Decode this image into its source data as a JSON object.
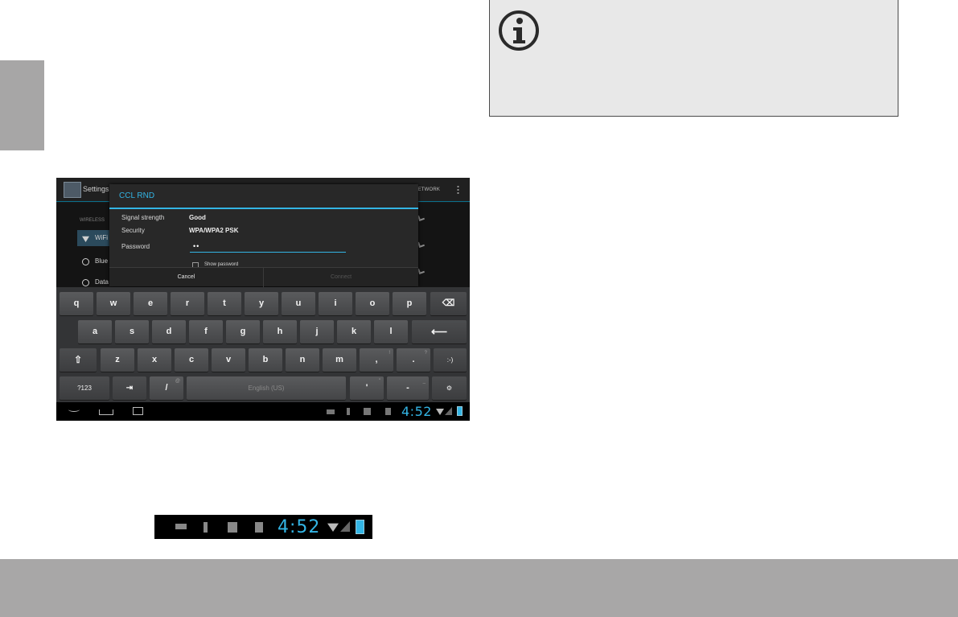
{
  "screenshot": {
    "app_title": "Settings",
    "action_label": "NETWORK",
    "wireless_header": "WIRELESS",
    "bg_items": [
      "WiFi",
      "Blue",
      "Data"
    ],
    "dialog": {
      "title": "CCL RND",
      "signal_label": "Signal strength",
      "signal_value": "Good",
      "security_label": "Security",
      "security_value": "WPA/WPA2 PSK",
      "password_label": "Password",
      "password_value": "••",
      "show_password": "Show password",
      "cancel": "Cancel",
      "connect": "Connect"
    },
    "keyboard": {
      "row1": [
        "q",
        "w",
        "e",
        "r",
        "t",
        "y",
        "u",
        "i",
        "o",
        "p"
      ],
      "row2": [
        "a",
        "s",
        "d",
        "f",
        "g",
        "h",
        "j",
        "k",
        "l"
      ],
      "row3": [
        "z",
        "x",
        "c",
        "v",
        "b",
        "n",
        "m",
        ",",
        "."
      ],
      "row3_sup": {
        "comma": "!",
        "period": "?"
      },
      "smiley": ":-)",
      "symbols": "?123",
      "slash": "/",
      "slash_sup": "@",
      "space": "English (US)",
      "apostrophe": "'",
      "apostrophe_sup": "\"",
      "dash": "-",
      "dash_sup": "_",
      "settings_glyph": "⚙",
      "tab_glyph": "⇥",
      "enter_glyph": "⟵",
      "shift_glyph": "⇧",
      "delete_glyph": "⌫"
    },
    "status": {
      "time": "4:52"
    }
  },
  "status_tray": {
    "time": "4:52"
  },
  "colors": {
    "side_tab": "#a7a6a6",
    "footer": "#a8a7a7",
    "note_bg": "#e8e8e8",
    "holo_blue": "#33b5e5"
  },
  "icons": {
    "info": "info-icon",
    "nav": [
      "back-icon",
      "home-icon",
      "recent-apps-icon"
    ],
    "status": [
      "keyboard-icon",
      "usb-icon",
      "debug-icon",
      "sd-card-icon",
      "wifi-icon",
      "signal-icon",
      "battery-icon"
    ]
  }
}
